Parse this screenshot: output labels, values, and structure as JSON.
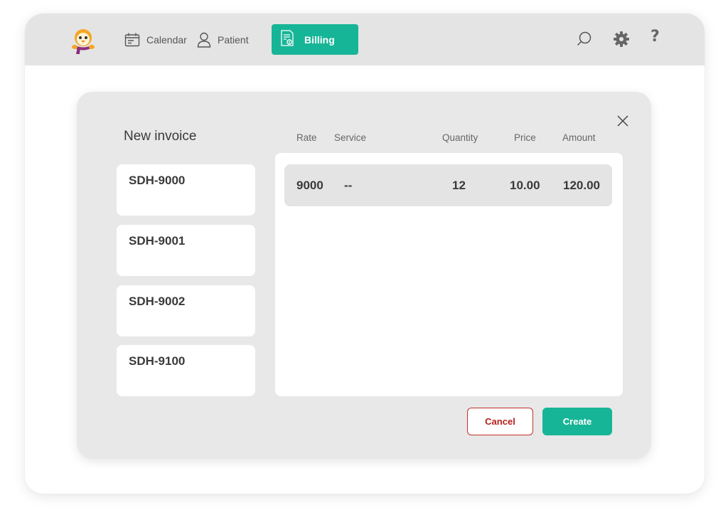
{
  "nav": {
    "calendar_label": "Calendar",
    "patient_label": "Patient",
    "billing_label": "Billing",
    "active_tab": "Billing",
    "icons": [
      "search-icon",
      "gear-icon",
      "help-icon"
    ],
    "help_glyph": "?"
  },
  "modal": {
    "title": "New invoice",
    "invoices": [
      {
        "id": "SDH-9000"
      },
      {
        "id": "SDH-9001"
      },
      {
        "id": "SDH-9002"
      },
      {
        "id": "SDH-9100"
      }
    ],
    "columns": {
      "rate": "Rate",
      "service": "Service",
      "quantity": "Quantity",
      "price": "Price",
      "amount": "Amount"
    },
    "rows": [
      {
        "rate": "9000",
        "service": "--",
        "quantity": "12",
        "price": "10.00",
        "amount": "120.00"
      }
    ],
    "cancel_label": "Cancel",
    "create_label": "Create"
  },
  "colors": {
    "accent": "#17b597",
    "cancel": "#b5201b",
    "topbar": "#e4e4e4",
    "modal_bg": "#e8e8e8"
  }
}
